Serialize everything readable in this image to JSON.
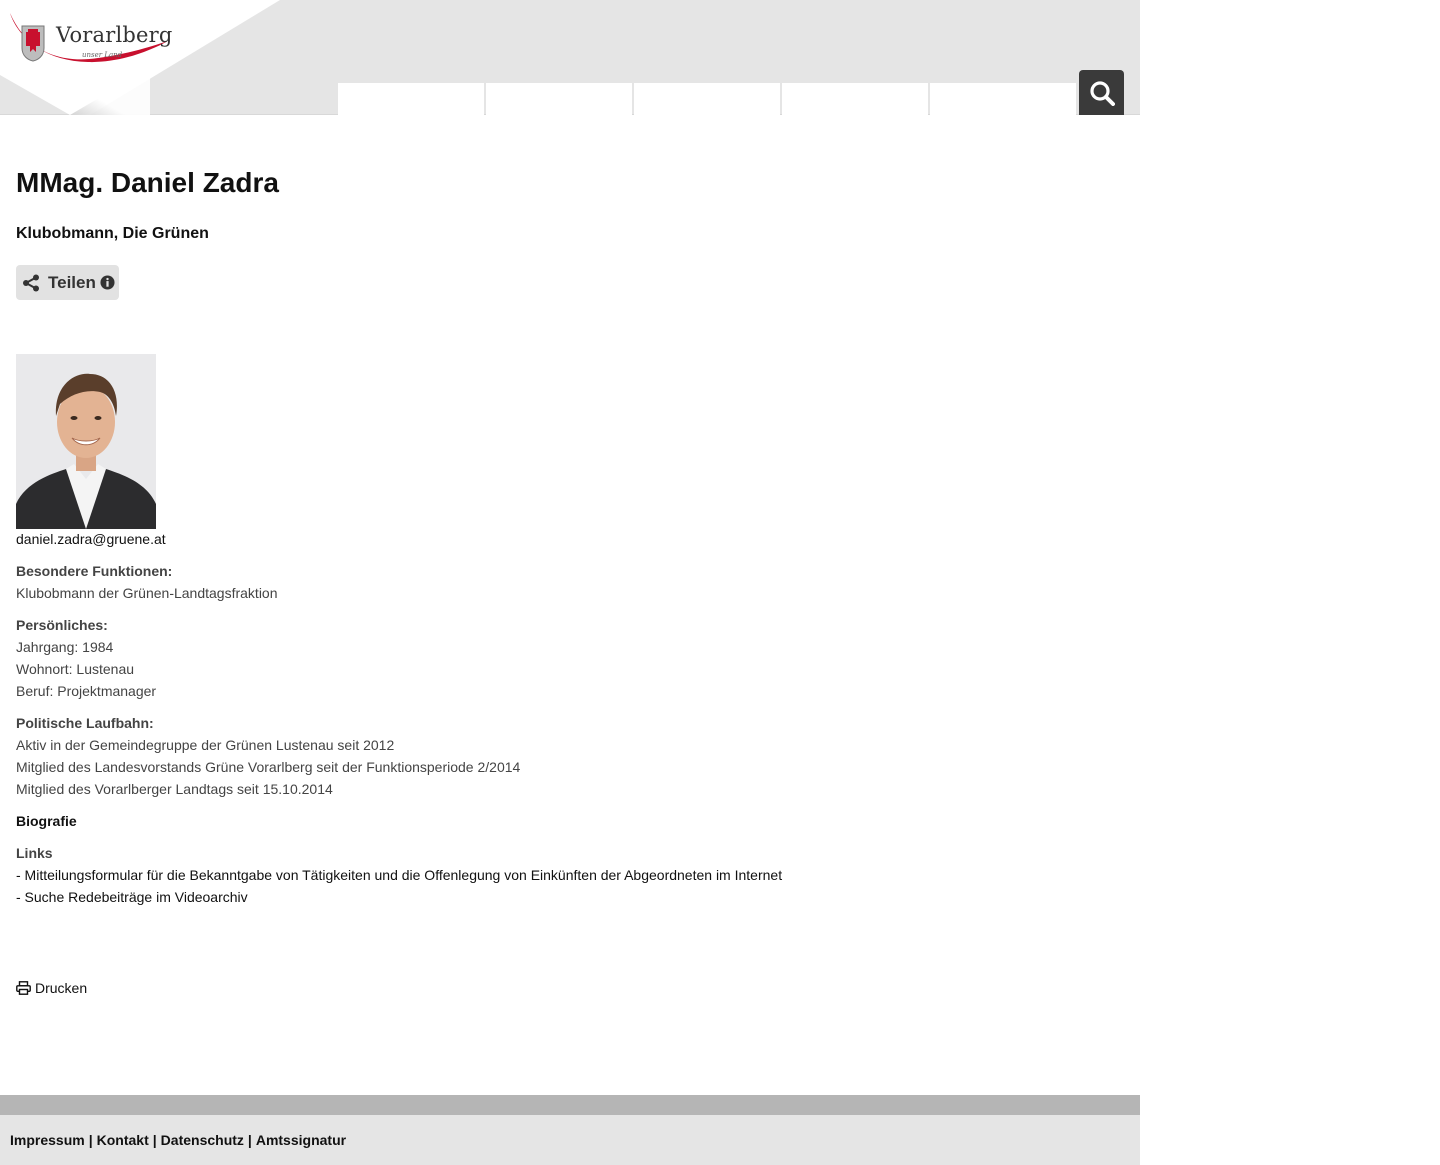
{
  "header": {
    "logo_text": "Vorarlberg",
    "logo_sub": "unser Land",
    "nav_items": [
      "",
      "",
      "",
      "",
      ""
    ]
  },
  "profile": {
    "name": "MMag. Daniel Zadra",
    "role": "Klubobmann, Die Grünen",
    "share_label": "Teilen",
    "email": "daniel.zadra@gruene.at",
    "sections": {
      "special_label": "Besondere Funktionen:",
      "special_lines": [
        "Klubobmann der Grünen-Landtagsfraktion"
      ],
      "personal_label": "Persönliches:",
      "personal_lines": [
        "Jahrgang: 1984",
        "Wohnort: Lustenau",
        "Beruf: Projektmanager"
      ],
      "career_label": "Politische Laufbahn:",
      "career_lines": [
        "Aktiv in der Gemeindegruppe der Grünen Lustenau seit 2012",
        "Mitglied des Landesvorstands Grüne Vorarlberg seit der Funktionsperiode 2/2014",
        "Mitglied des Vorarlberger Landtags seit 15.10.2014"
      ],
      "bio_label": "Biografie",
      "links_label": "Links",
      "links": [
        "- Mitteilungsformular für die Bekanntgabe von Tätigkeiten und die Offenlegung von Einkünften der Abgeordneten im Internet",
        "- Suche Redebeiträge im Videoarchiv"
      ]
    },
    "print_label": "Drucken"
  },
  "footer": {
    "links": [
      "Impressum",
      "Kontakt",
      "Datenschutz",
      "Amtssignatur"
    ],
    "separator": "|"
  },
  "colors": {
    "header_bg": "#e5e5e5",
    "accent_red": "#c8102e",
    "search_bg": "#3a3a3a",
    "footer_bar": "#b5b5b5"
  }
}
